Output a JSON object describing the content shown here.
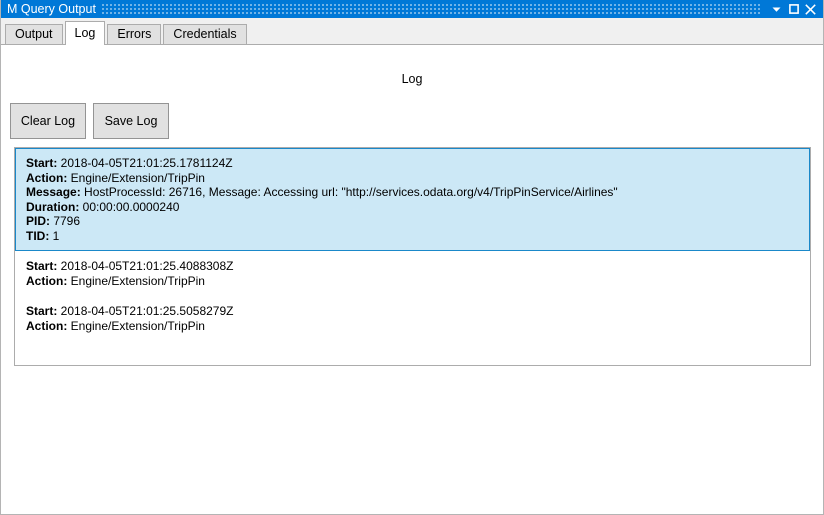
{
  "window": {
    "title": "M Query Output",
    "controls": [
      {
        "name": "dropdown",
        "glyph": "triangle-down"
      },
      {
        "name": "maximize",
        "glyph": "square"
      },
      {
        "name": "close",
        "glyph": "x"
      }
    ]
  },
  "tabs": [
    {
      "label": "Output",
      "active": false
    },
    {
      "label": "Log",
      "active": true
    },
    {
      "label": "Errors",
      "active": false
    },
    {
      "label": "Credentials",
      "active": false
    }
  ],
  "panel": {
    "title": "Log",
    "buttons": [
      {
        "label": "Clear Log",
        "name": "clear-log-button"
      },
      {
        "label": "Save Log",
        "name": "save-log-button"
      }
    ]
  },
  "log_entries": [
    {
      "selected": true,
      "fields": [
        {
          "label": "Start:",
          "value": "2018-04-05T21:01:25.1781124Z"
        },
        {
          "label": "Action:",
          "value": "Engine/Extension/TripPin"
        },
        {
          "label": "Message:",
          "value": "HostProcessId: 26716, Message: Accessing url: \"http://services.odata.org/v4/TripPinService/Airlines\""
        },
        {
          "label": "Duration:",
          "value": "00:00:00.0000240"
        },
        {
          "label": "PID:",
          "value": "7796"
        },
        {
          "label": "TID:",
          "value": "1"
        }
      ]
    },
    {
      "selected": false,
      "fields": [
        {
          "label": "Start:",
          "value": "2018-04-05T21:01:25.4088308Z"
        },
        {
          "label": "Action:",
          "value": "Engine/Extension/TripPin"
        }
      ]
    },
    {
      "selected": false,
      "fields": [
        {
          "label": "Start:",
          "value": "2018-04-05T21:01:25.5058279Z"
        },
        {
          "label": "Action:",
          "value": "Engine/Extension/TripPin"
        }
      ]
    }
  ],
  "colors": {
    "titlebar": "#0078d7",
    "selection_fill": "#cce8f6",
    "selection_border": "#1a88c9",
    "button_face": "#e1e1e1",
    "tab_inactive": "#e1e1e1",
    "tabstrip": "#f0f0f0",
    "border": "#acacac"
  }
}
